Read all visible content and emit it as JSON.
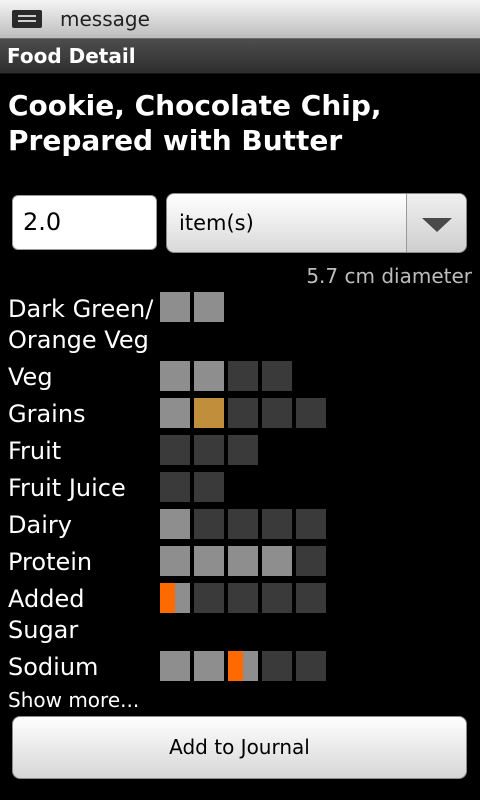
{
  "status_bar": {
    "notification": "message",
    "icon": "message-icon"
  },
  "title_bar": {
    "title": "Food Detail"
  },
  "food": {
    "name": "Cookie, Chocolate Chip, Prepared with Butter"
  },
  "serving": {
    "quantity": "2.0",
    "unit": "item(s)",
    "unit_dropdown_icon": "chevron-down-icon",
    "note": "5.7 cm diameter"
  },
  "groups": [
    {
      "label": "Dark Green/\nOrange Veg",
      "boxes": [
        "full",
        "full"
      ]
    },
    {
      "label": "Veg",
      "boxes": [
        "full",
        "full",
        "empty",
        "empty"
      ]
    },
    {
      "label": "Grains",
      "boxes": [
        "full",
        "over",
        "empty",
        "empty",
        "empty"
      ]
    },
    {
      "label": "Fruit",
      "boxes": [
        "empty",
        "empty",
        "empty"
      ]
    },
    {
      "label": "Fruit Juice",
      "boxes": [
        "empty",
        "empty"
      ]
    },
    {
      "label": "Dairy",
      "boxes": [
        "full",
        "empty",
        "empty",
        "empty",
        "empty"
      ]
    },
    {
      "label": "Protein",
      "boxes": [
        "full",
        "full",
        "full",
        "full",
        "empty"
      ]
    },
    {
      "label": "Added\nSugar",
      "boxes": [
        "partial:0.5",
        "empty",
        "empty",
        "empty",
        "empty"
      ]
    },
    {
      "label": "Sodium",
      "boxes": [
        "full",
        "full",
        "partial:0.5",
        "empty",
        "empty"
      ]
    }
  ],
  "show_more": "Show more...",
  "add_button": "Add to Journal",
  "colors": {
    "filled": "#8e8e8e",
    "empty": "#3a3a3a",
    "over": "#c18f3b",
    "partial": "#ff6a00"
  }
}
